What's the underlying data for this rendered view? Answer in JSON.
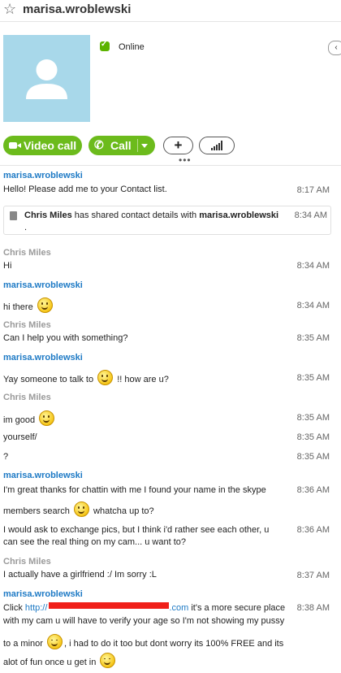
{
  "header": {
    "contact_name": "marisa.wroblewski",
    "status": "Online"
  },
  "actions": {
    "video_call": "Video call",
    "call": "Call"
  },
  "messages": [
    {
      "sender": "marisa.wroblewski",
      "text": "Hello! Please add me to your Contact list.",
      "time": "8:17 AM"
    },
    {
      "system": true,
      "actor": "Chris Miles",
      "text": "has shared contact details with",
      "target": "marisa.wroblewski",
      "suffix": ".",
      "time": "8:34 AM"
    },
    {
      "sender": "Chris Miles",
      "text": "Hi",
      "time": "8:34 AM"
    },
    {
      "sender": "marisa.wroblewski",
      "text": "hi there",
      "time": "8:34 AM"
    },
    {
      "sender": "Chris Miles",
      "text": "Can I help  you with something?",
      "time": "8:35 AM"
    },
    {
      "sender": "marisa.wroblewski",
      "text_a": "Yay someone to talk to",
      "text_b": "!! how are u?",
      "time": "8:35 AM"
    },
    {
      "sender": "Chris Miles",
      "lines": [
        {
          "text": "im good",
          "time": "8:35 AM"
        },
        {
          "text": "yourself/",
          "time": "8:35 AM"
        },
        {
          "text": "?",
          "time": "8:35 AM"
        }
      ]
    },
    {
      "sender": "marisa.wroblewski",
      "parts": [
        {
          "line1": "I'm great thanks for chattin with me I found your name in the skype",
          "line2a": "members search",
          "line2b": "whatcha up to?",
          "time": "8:36 AM"
        },
        {
          "line1": "I would ask to exchange pics, but I think i'd rather see each other, u",
          "line2": "can see the real thing on my cam... u want to?",
          "time": "8:36 AM"
        }
      ]
    },
    {
      "sender": "Chris Miles",
      "text": "I actually have a girlfriend :/ Im sorry :L",
      "time": "8:37 AM"
    },
    {
      "sender": "marisa.wroblewski",
      "line1_a": "Click",
      "link_start": "http://",
      "link_end": ".com",
      "line1_b": "it's a more secure place",
      "line2": "with my cam u will have to verify your age so I'm not showing my pussy",
      "line3a": "to a minor",
      "line3b": ", i had to do it too but dont worry its 100% FREE and its",
      "line4a": "alot of fun once u get in",
      "time": "8:38 AM"
    }
  ]
}
